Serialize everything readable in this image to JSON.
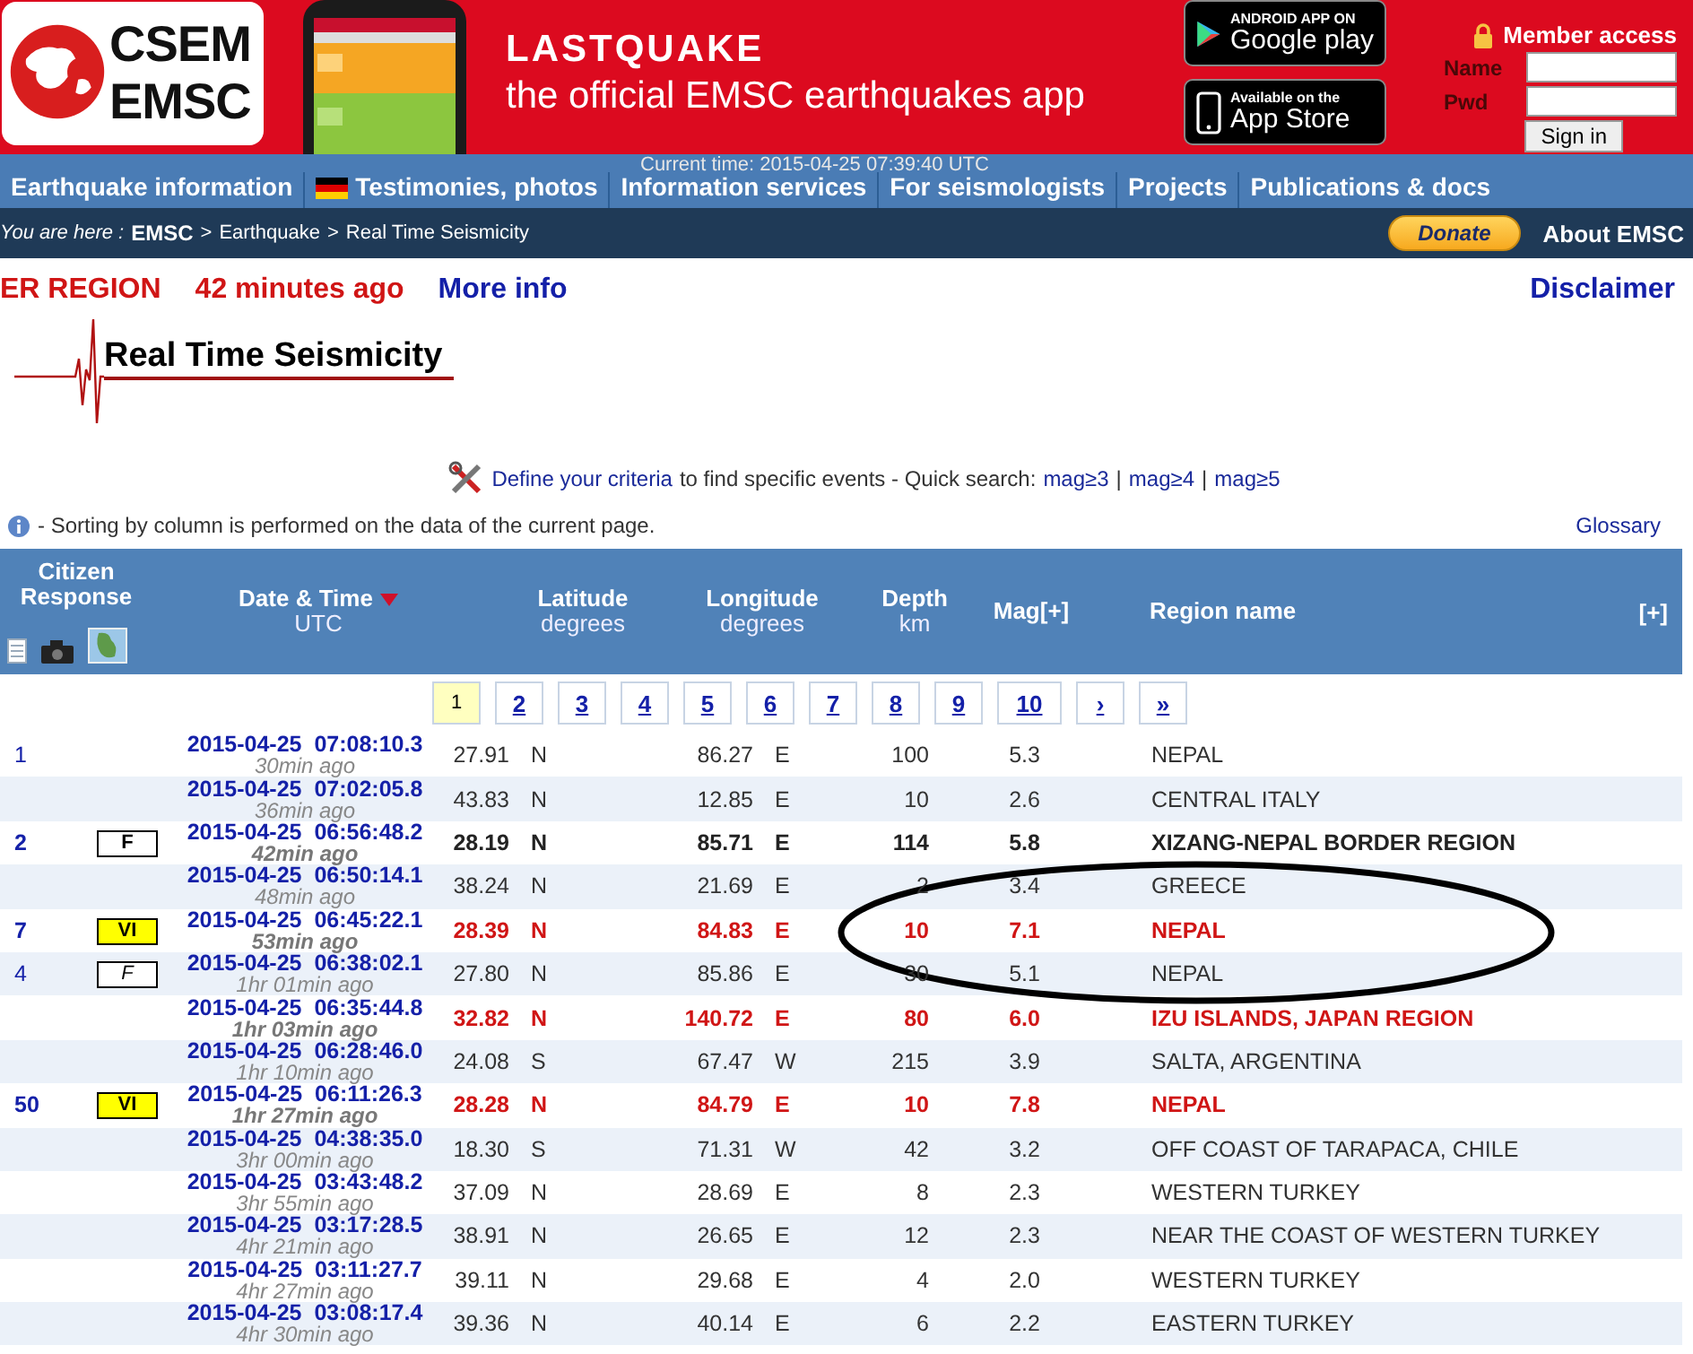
{
  "banner": {
    "logo": [
      "CSEM",
      "EMSC"
    ],
    "app_name": "LASTQUAKE",
    "app_tagline": "the official EMSC earthquakes app",
    "stores": [
      {
        "kind": "google",
        "small": "ANDROID APP ON",
        "big": "Google play"
      },
      {
        "kind": "apple",
        "small": "Available on the",
        "big": "App Store"
      }
    ],
    "member": {
      "title": "Member access",
      "name_label": "Name",
      "pwd_label": "Pwd",
      "button": "Sign in"
    }
  },
  "current_time": "Current time: 2015-04-25 07:39:40 UTC",
  "nav": [
    {
      "label": "Earthquake information",
      "flag": false
    },
    {
      "label": "Testimonies, photos",
      "flag": true
    },
    {
      "label": "Information services",
      "flag": false
    },
    {
      "label": "For seismologists",
      "flag": false
    },
    {
      "label": "Projects",
      "flag": false
    },
    {
      "label": "Publications & docs",
      "flag": false
    }
  ],
  "breadcrumb": {
    "prefix": "You are here :",
    "items": [
      "EMSC",
      "Earthquake",
      "Real Time Seismicity"
    ],
    "separator": ">",
    "donate": "Donate",
    "about": "About EMSC"
  },
  "alert": {
    "region": "ER REGION",
    "ago": "42 minutes ago",
    "more": "More info",
    "disclaimer": "Disclaimer"
  },
  "page_title": "Real Time Seismicity",
  "criteria": {
    "link": "Define your criteria",
    "text": "to find specific events - Quick search:",
    "quick": [
      "mag≥3",
      "mag≥4",
      "mag≥5"
    ],
    "separator": "|"
  },
  "info": {
    "text": "- Sorting by column is performed on the data of the current page.",
    "glossary": "Glossary"
  },
  "table": {
    "columns": [
      {
        "title": "Citizen Response"
      },
      {
        "title": "Date & Time",
        "sub": "UTC",
        "sorted": true
      },
      {
        "title": "Latitude",
        "sub": "degrees"
      },
      {
        "title": "Longitude",
        "sub": "degrees"
      },
      {
        "title": "Depth",
        "sub": "km"
      },
      {
        "title": "Mag[+]"
      },
      {
        "title": "Region name"
      }
    ],
    "expand": "[+]",
    "pages": [
      {
        "label": "1",
        "selected": true
      },
      {
        "label": "2",
        "selected": false
      },
      {
        "label": "3",
        "selected": false
      },
      {
        "label": "4",
        "selected": false
      },
      {
        "label": "5",
        "selected": false
      },
      {
        "label": "6",
        "selected": false
      },
      {
        "label": "7",
        "selected": false
      },
      {
        "label": "8",
        "selected": false
      },
      {
        "label": "9",
        "selected": false
      },
      {
        "label": "10",
        "selected": false
      },
      {
        "label": "›",
        "selected": false
      },
      {
        "label": "»",
        "selected": false
      }
    ],
    "rows": [
      {
        "responses": "1",
        "datetime": "2015-04-25  07:08:10.3",
        "ago": "30min ago",
        "lat": "27.91",
        "ns": "N",
        "lon": "86.27",
        "ew": "E",
        "depth": "100",
        "mag": "5.3",
        "region": "NEPAL",
        "bold": false,
        "red": false
      },
      {
        "datetime": "2015-04-25  07:02:05.8",
        "ago": "36min ago",
        "lat": "43.83",
        "ns": "N",
        "lon": "12.85",
        "ew": "E",
        "depth": "10",
        "mag": "2.6",
        "region": "CENTRAL ITALY",
        "bold": false,
        "red": false
      },
      {
        "responses": "2",
        "badge": {
          "text": "F",
          "color": "#ffffff",
          "italic": false
        },
        "datetime": "2015-04-25  06:56:48.2",
        "ago": "42min ago",
        "lat": "28.19",
        "ns": "N",
        "lon": "85.71",
        "ew": "E",
        "depth": "114",
        "mag": "5.8",
        "region": "XIZANG-NEPAL BORDER REGION",
        "bold": true,
        "red": false
      },
      {
        "datetime": "2015-04-25  06:50:14.1",
        "ago": "48min ago",
        "lat": "38.24",
        "ns": "N",
        "lon": "21.69",
        "ew": "E",
        "depth": "2",
        "mag": "3.4",
        "region": "GREECE",
        "bold": false,
        "red": false
      },
      {
        "responses": "7",
        "badge": {
          "text": "VI",
          "color": "#ffff00",
          "italic": false
        },
        "datetime": "2015-04-25  06:45:22.1",
        "ago": "53min ago",
        "lat": "28.39",
        "ns": "N",
        "lon": "84.83",
        "ew": "E",
        "depth": "10",
        "mag": "7.1",
        "region": "NEPAL",
        "bold": true,
        "red": true
      },
      {
        "responses": "4",
        "badge": {
          "text": "F",
          "color": "#ffffff",
          "italic": true
        },
        "datetime": "2015-04-25  06:38:02.1",
        "ago": "1hr 01min ago",
        "lat": "27.80",
        "ns": "N",
        "lon": "85.86",
        "ew": "E",
        "depth": "30",
        "mag": "5.1",
        "region": "NEPAL",
        "bold": false,
        "red": false
      },
      {
        "datetime": "2015-04-25  06:35:44.8",
        "ago": "1hr 03min ago",
        "lat": "32.82",
        "ns": "N",
        "lon": "140.72",
        "ew": "E",
        "depth": "80",
        "mag": "6.0",
        "region": "IZU ISLANDS, JAPAN REGION",
        "bold": true,
        "red": true
      },
      {
        "datetime": "2015-04-25  06:28:46.0",
        "ago": "1hr 10min ago",
        "lat": "24.08",
        "ns": "S",
        "lon": "67.47",
        "ew": "W",
        "depth": "215",
        "mag": "3.9",
        "region": "SALTA, ARGENTINA",
        "bold": false,
        "red": false
      },
      {
        "responses": "50",
        "badge": {
          "text": "VI",
          "color": "#ffff00",
          "italic": false
        },
        "datetime": "2015-04-25  06:11:26.3",
        "ago": "1hr 27min ago",
        "lat": "28.28",
        "ns": "N",
        "lon": "84.79",
        "ew": "E",
        "depth": "10",
        "mag": "7.8",
        "region": "NEPAL",
        "bold": true,
        "red": true
      },
      {
        "datetime": "2015-04-25  04:38:35.0",
        "ago": "3hr 00min ago",
        "lat": "18.30",
        "ns": "S",
        "lon": "71.31",
        "ew": "W",
        "depth": "42",
        "mag": "3.2",
        "region": "OFF COAST OF TARAPACA, CHILE",
        "bold": false,
        "red": false
      },
      {
        "datetime": "2015-04-25  03:43:48.2",
        "ago": "3hr 55min ago",
        "lat": "37.09",
        "ns": "N",
        "lon": "28.69",
        "ew": "E",
        "depth": "8",
        "mag": "2.3",
        "region": "WESTERN TURKEY",
        "bold": false,
        "red": false
      },
      {
        "datetime": "2015-04-25  03:17:28.5",
        "ago": "4hr 21min ago",
        "lat": "38.91",
        "ns": "N",
        "lon": "26.65",
        "ew": "E",
        "depth": "12",
        "mag": "2.3",
        "region": "NEAR THE COAST OF WESTERN TURKEY",
        "bold": false,
        "red": false
      },
      {
        "datetime": "2015-04-25  03:11:27.7",
        "ago": "4hr 27min ago",
        "lat": "39.11",
        "ns": "N",
        "lon": "29.68",
        "ew": "E",
        "depth": "4",
        "mag": "2.0",
        "region": "WESTERN TURKEY",
        "bold": false,
        "red": false
      },
      {
        "datetime": "2015-04-25  03:08:17.4",
        "ago": "4hr 30min ago",
        "lat": "39.36",
        "ns": "N",
        "lon": "40.14",
        "ew": "E",
        "depth": "6",
        "mag": "2.2",
        "region": "EASTERN TURKEY",
        "bold": false,
        "red": false
      }
    ]
  },
  "annotation": {
    "kind": "ellipse"
  }
}
